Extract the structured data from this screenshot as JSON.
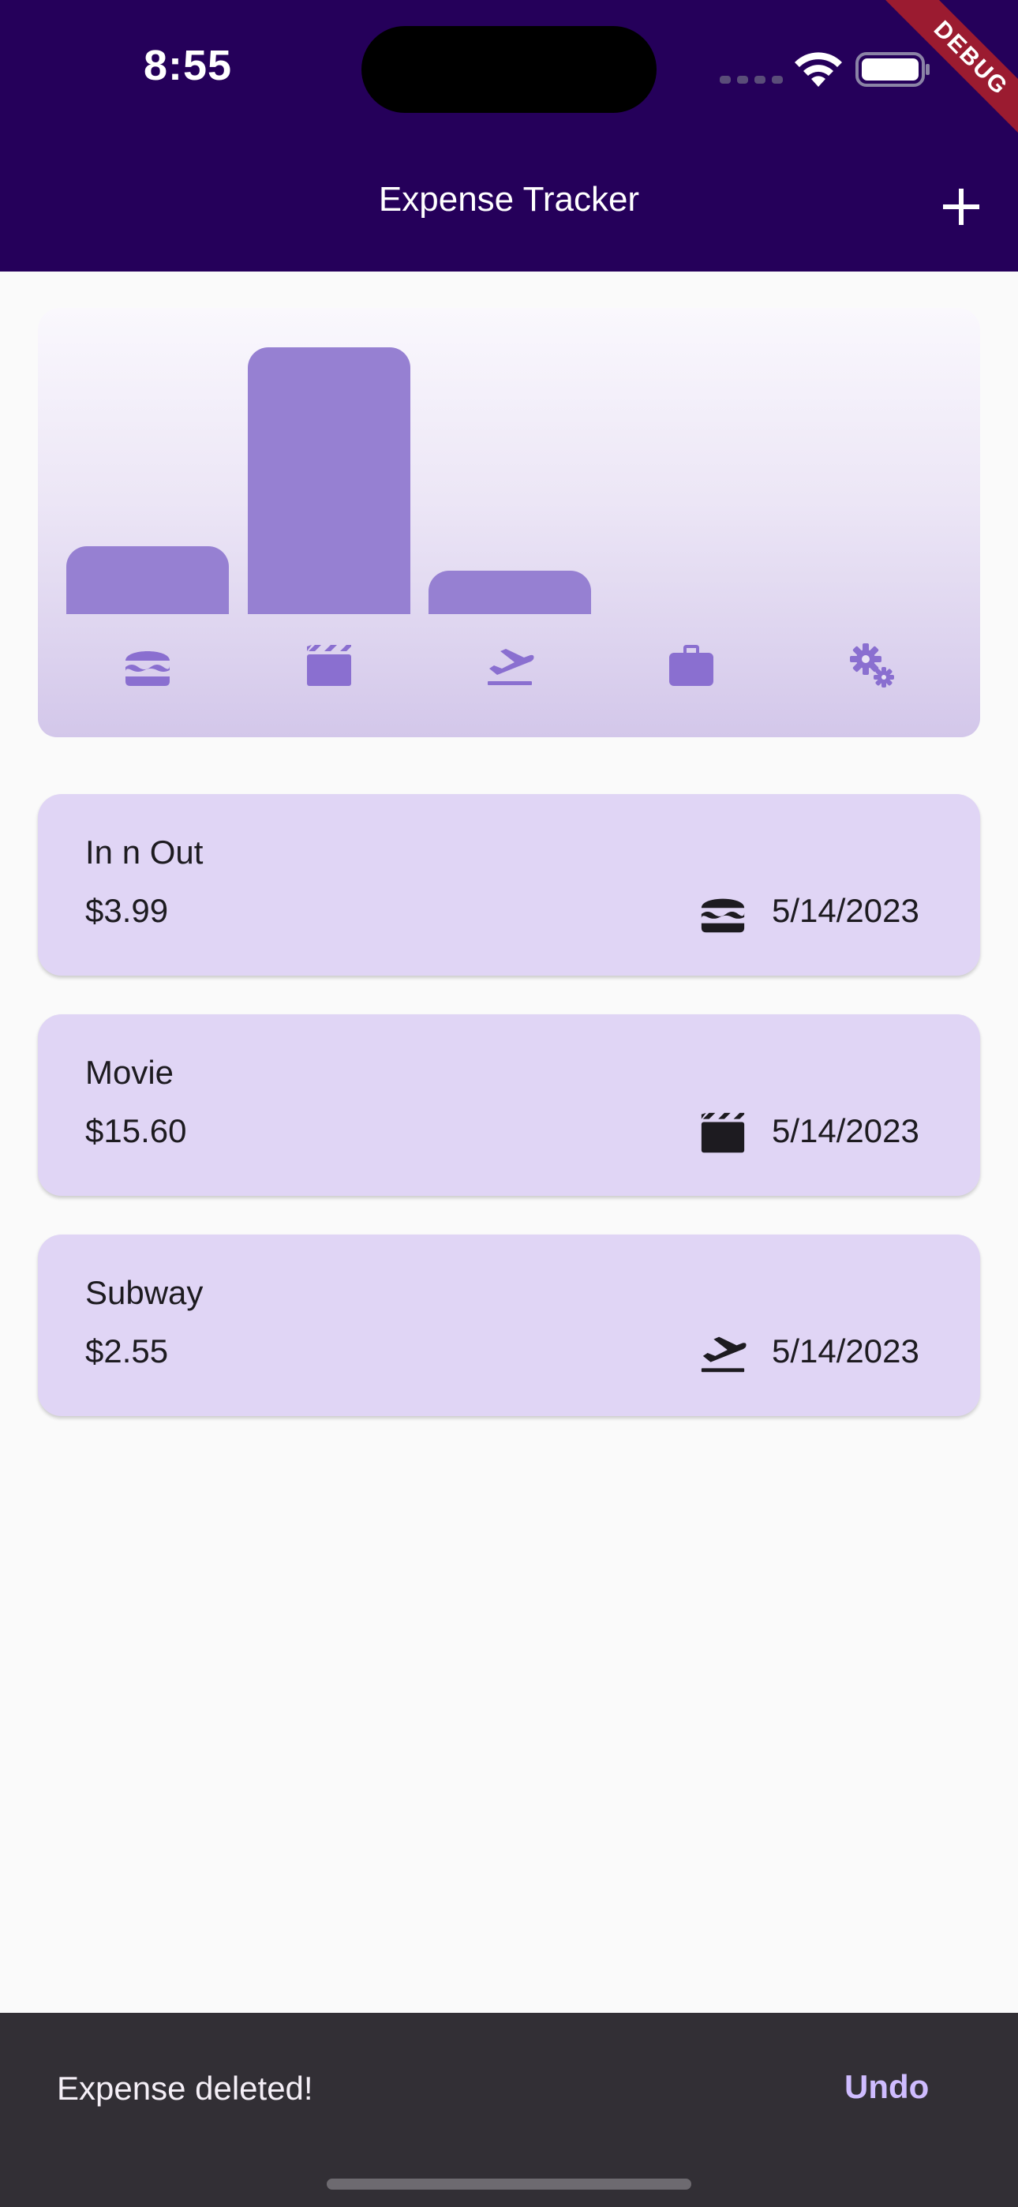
{
  "status_bar": {
    "time": "8:55",
    "debug_banner": "DEBUG"
  },
  "app_bar": {
    "title": "Expense Tracker",
    "add_icon": "plus-icon"
  },
  "colors": {
    "app_bar": "#25005a",
    "bar": "#9680d2",
    "card": "#e0d5f5",
    "snackbar": "#322f35",
    "undo": "#cfbcff"
  },
  "chart_data": {
    "type": "bar",
    "categories": [
      "food",
      "leisure",
      "travel",
      "work",
      "settings"
    ],
    "category_icons": [
      "hamburger-icon",
      "clapperboard-icon",
      "flight-takeoff-icon",
      "briefcase-icon",
      "gears-icon"
    ],
    "values": [
      3.99,
      15.6,
      2.55,
      0,
      0
    ],
    "ylim": [
      0,
      15.6
    ],
    "grid": false
  },
  "expenses": [
    {
      "title": "In n Out",
      "amount": "$3.99",
      "date": "5/14/2023",
      "icon": "hamburger-icon"
    },
    {
      "title": "Movie",
      "amount": "$15.60",
      "date": "5/14/2023",
      "icon": "clapperboard-icon"
    },
    {
      "title": "Subway",
      "amount": "$2.55",
      "date": "5/14/2023",
      "icon": "flight-takeoff-icon"
    }
  ],
  "snackbar": {
    "message": "Expense deleted!",
    "action_label": "Undo"
  }
}
